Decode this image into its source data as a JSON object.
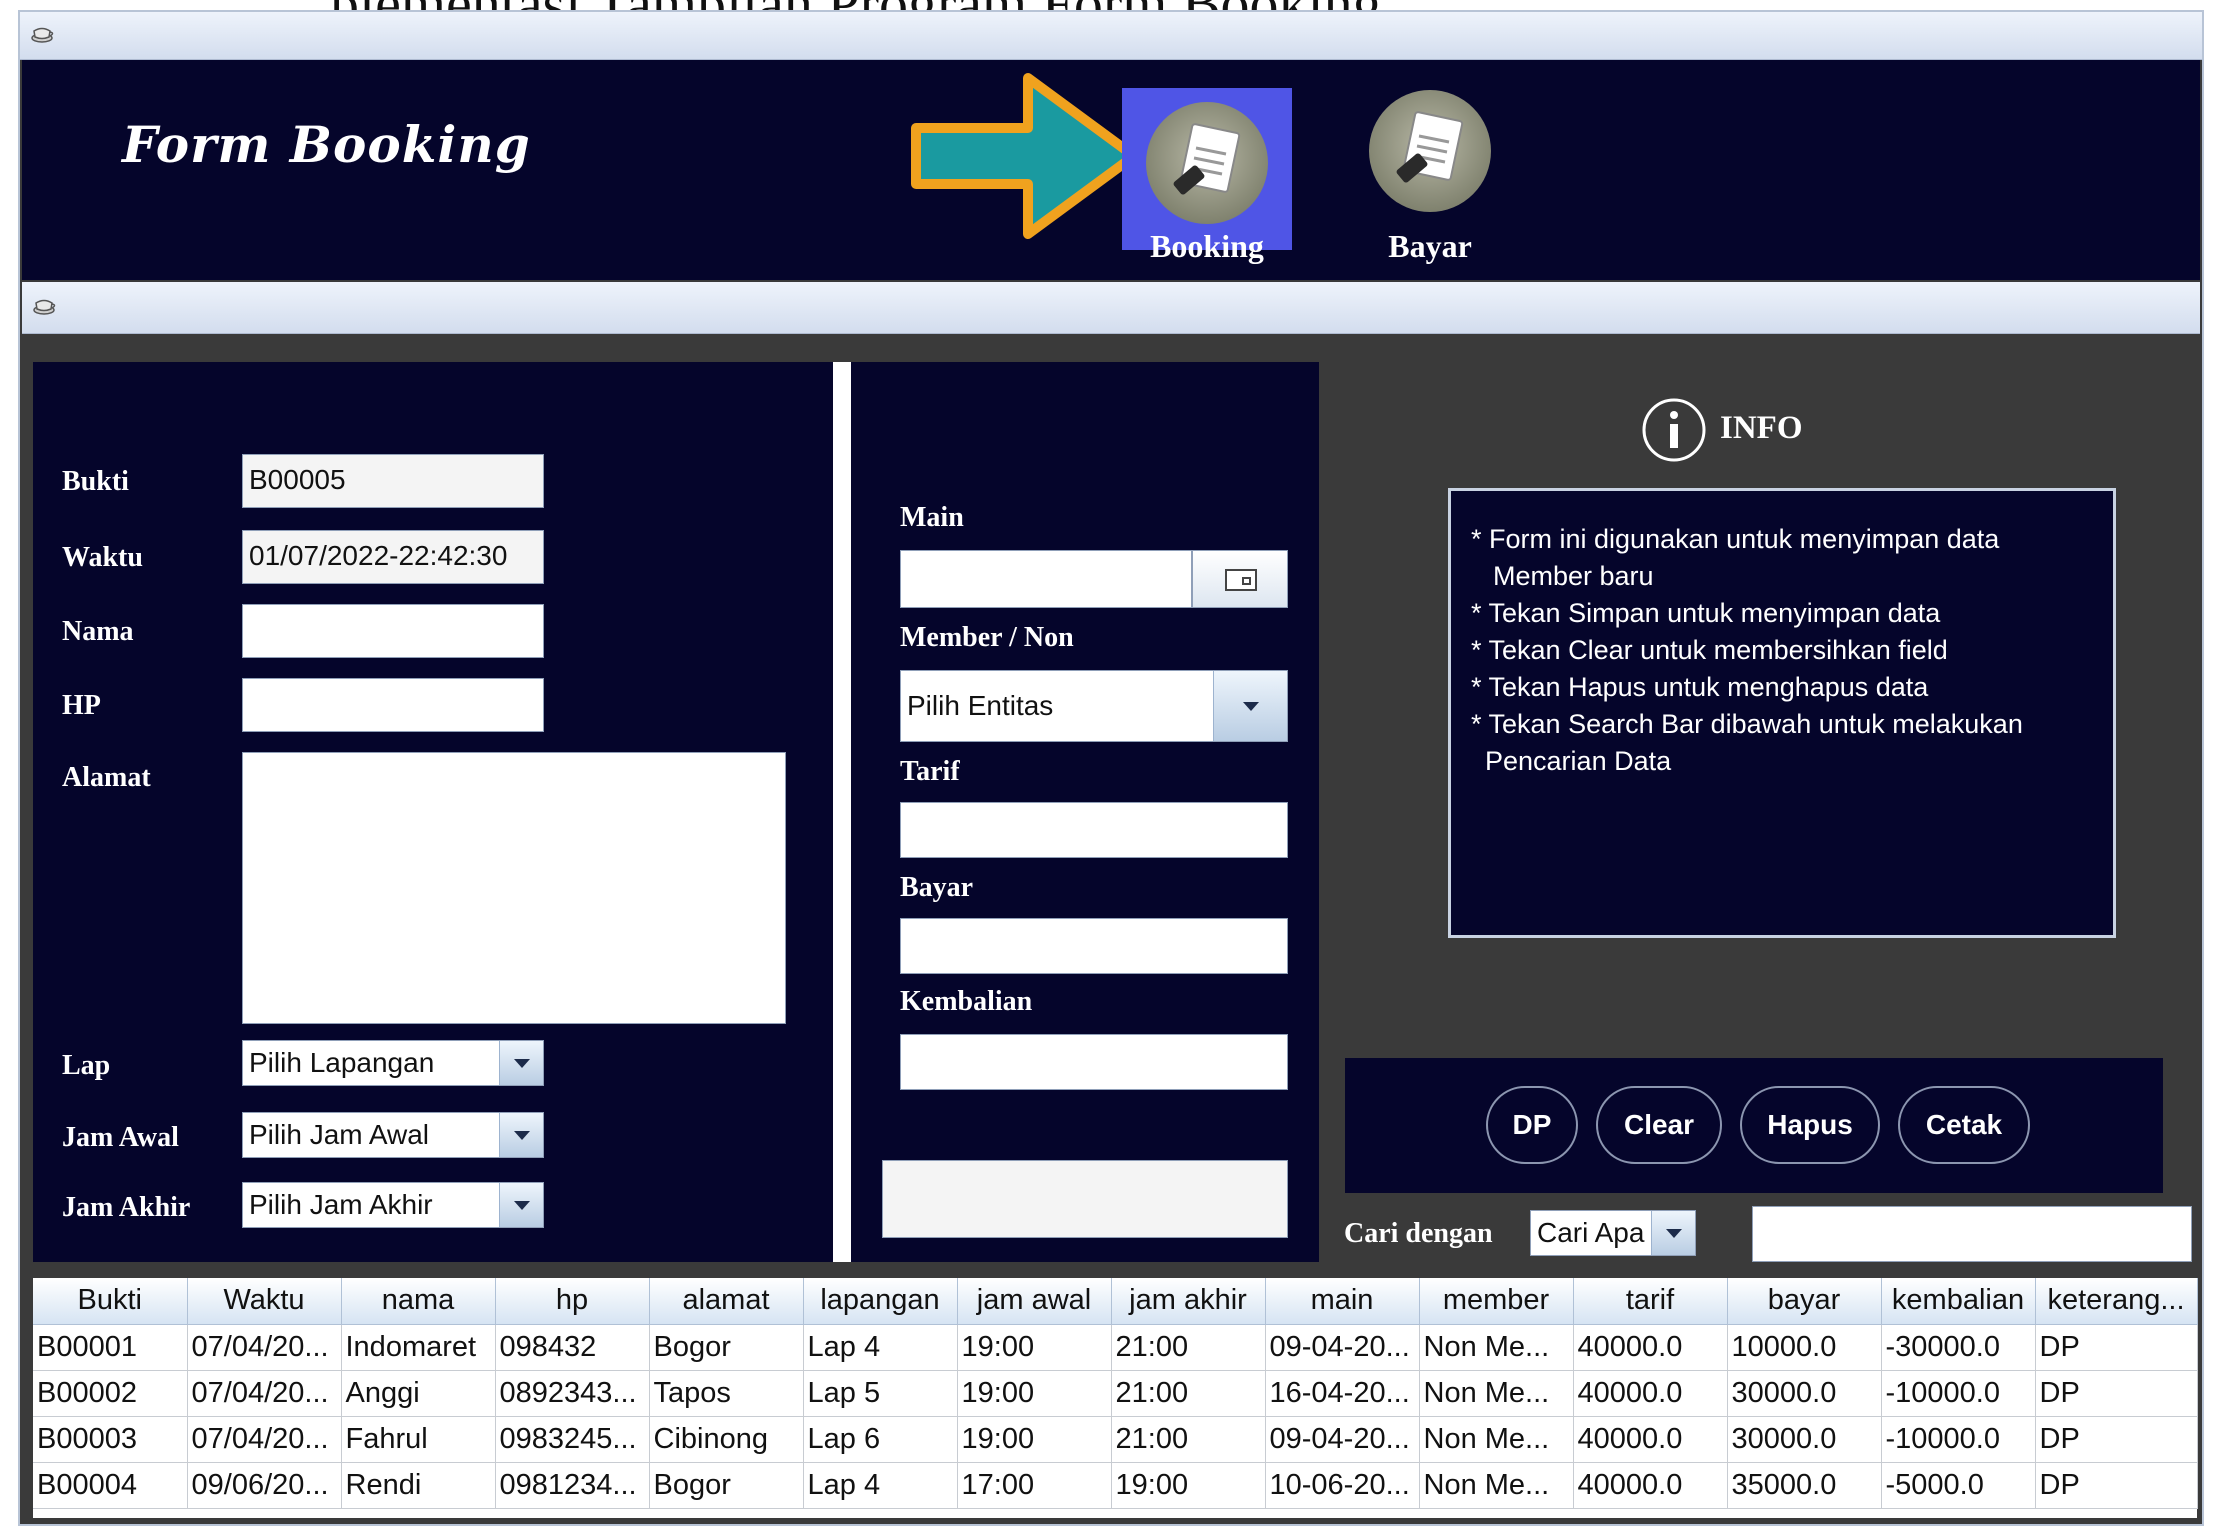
{
  "top_clip_text": "plementasi Tampilan Program Form Booking",
  "header": {
    "title": "Form Booking",
    "nav": [
      {
        "label": "Booking",
        "active": true
      },
      {
        "label": "Bayar",
        "active": false
      }
    ]
  },
  "left_form": {
    "bukti": {
      "label": "Bukti",
      "value": "B00005"
    },
    "waktu": {
      "label": "Waktu",
      "value": "01/07/2022-22:42:30"
    },
    "nama": {
      "label": "Nama",
      "value": ""
    },
    "hp": {
      "label": "HP",
      "value": ""
    },
    "alamat": {
      "label": "Alamat",
      "value": ""
    },
    "lap": {
      "label": "Lap",
      "selected": "Pilih Lapangan"
    },
    "jam_awal": {
      "label": "Jam Awal",
      "selected": "Pilih Jam Awal"
    },
    "jam_akhir": {
      "label": "Jam Akhir",
      "selected": "Pilih Jam Akhir"
    }
  },
  "mid_form": {
    "main": {
      "label": "Main",
      "value": ""
    },
    "member": {
      "label": "Member / Non",
      "selected": "Pilih Entitas"
    },
    "tarif": {
      "label": "Tarif",
      "value": ""
    },
    "bayar": {
      "label": "Bayar",
      "value": ""
    },
    "kembalian": {
      "label": "Kembalian",
      "value": ""
    }
  },
  "info": {
    "title": "INFO",
    "lines": [
      "* Form ini digunakan untuk menyimpan data",
      "  Member baru",
      "* Tekan Simpan untuk menyimpan data",
      "* Tekan Clear untuk membersihkan field",
      "* Tekan Hapus untuk menghapus data",
      "* Tekan Search Bar dibawah untuk melakukan",
      " Pencarian Data"
    ]
  },
  "actions": {
    "dp": "DP",
    "clear": "Clear",
    "hapus": "Hapus",
    "cetak": "Cetak"
  },
  "search": {
    "label": "Cari dengan",
    "selected": "Cari Apa ?",
    "value": ""
  },
  "table": {
    "columns": [
      "Bukti",
      "Waktu",
      "nama",
      "hp",
      "alamat",
      "lapangan",
      "jam awal",
      "jam akhir",
      "main",
      "member",
      "tarif",
      "bayar",
      "kembalian",
      "keterang..."
    ],
    "rows": [
      [
        "B00001",
        "07/04/20...",
        "Indomaret",
        "098432",
        "Bogor",
        "Lap 4",
        "19:00",
        "21:00",
        "09-04-20...",
        "Non Me...",
        "40000.0",
        "10000.0",
        "-30000.0",
        "DP"
      ],
      [
        "B00002",
        "07/04/20...",
        "Anggi",
        "0892343...",
        "Tapos",
        "Lap 5",
        "19:00",
        "21:00",
        "16-04-20...",
        "Non Me...",
        "40000.0",
        "30000.0",
        "-10000.0",
        "DP"
      ],
      [
        "B00003",
        "07/04/20...",
        "Fahrul",
        "0983245...",
        "Cibinong",
        "Lap 6",
        "19:00",
        "21:00",
        "09-04-20...",
        "Non Me...",
        "40000.0",
        "30000.0",
        "-10000.0",
        "DP"
      ],
      [
        "B00004",
        "09/06/20...",
        "Rendi",
        "0981234...",
        "Bogor",
        "Lap 4",
        "17:00",
        "19:00",
        "10-06-20...",
        "Non Me...",
        "40000.0",
        "35000.0",
        "-5000.0",
        "DP"
      ]
    ]
  }
}
